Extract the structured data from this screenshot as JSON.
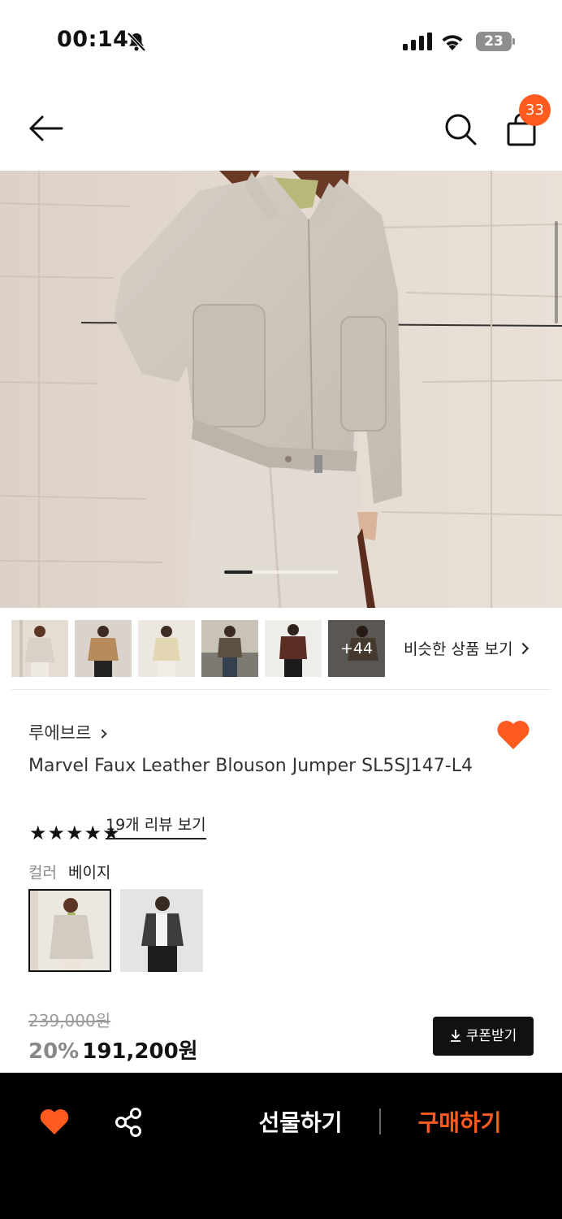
{
  "status_bar": {
    "time": "00:14",
    "battery": "23",
    "icons": [
      "bell-off-icon",
      "cellular-signal-icon",
      "wifi-icon",
      "battery-icon"
    ]
  },
  "header": {
    "icons": [
      "arrow-left-icon",
      "search-icon",
      "shopping-bag-icon"
    ],
    "cart_count": "33"
  },
  "gallery": {
    "current_slide_fraction": 0.25,
    "more_count": "+44",
    "similar_link": "비슷한 상품 보기"
  },
  "product": {
    "brand": "루에브르",
    "title": "Marvel Faux Leather Blouson Jumper SL5SJ147-L4",
    "stars": "★★★★★",
    "rating": 5,
    "review_link": "19개 리뷰 보기",
    "color_label": "컬러",
    "color_value": "베이지",
    "wishlisted": true
  },
  "price": {
    "original": "239,000원",
    "discount": "20%",
    "current": "191,200원",
    "coupon_button": "쿠폰받기"
  },
  "bottom_bar": {
    "gift_button": "선물하기",
    "buy_button": "구매하기",
    "icons": [
      "heart-icon",
      "share-icon"
    ]
  },
  "colors": {
    "accent": "#ff5a1f",
    "bottom_bar_bg": "#000000",
    "text_primary": "#111111"
  }
}
